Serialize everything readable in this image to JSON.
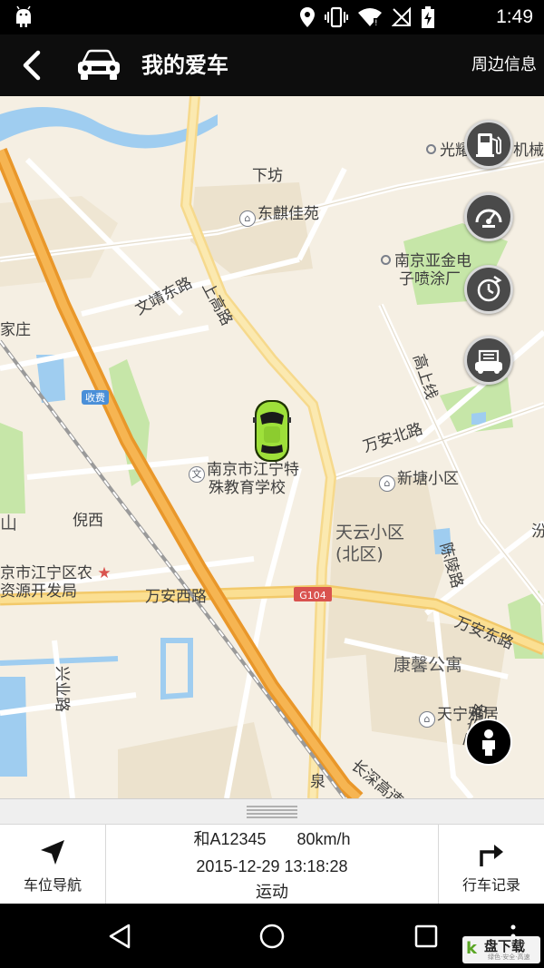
{
  "status_bar": {
    "time": "1:49"
  },
  "header": {
    "title": "我的爱车",
    "nearby_label": "周边信息"
  },
  "map": {
    "labels": {
      "xiafang": "下坊",
      "donglin": "东麒佳苑",
      "guang": "光耀",
      "jixie": "机械厂",
      "yajin1": "南京亚金电",
      "yajin2": "子喷涂厂",
      "wenjing": "文靖东路",
      "shanggao": "上高路",
      "jiazhuang": "家庄",
      "shoufei": "收费",
      "gaoshang": "高上线",
      "wanan_n": "万安北路",
      "school1": "南京市江宁特",
      "school2": "殊教育学校",
      "xintang": "新塘小区",
      "tianyun1": "天云小区",
      "tianyun2": "(北区)",
      "shan": "山",
      "nixi": "倪西",
      "jiangning1": "京市江宁区农",
      "jiangning2": "资源开发局",
      "wanan_w": "万安西路",
      "g104": "G104",
      "chenling": "陈陵路",
      "wanan_e": "万安东路",
      "kangxin": "康馨公寓",
      "tianning": "天宁雅居",
      "xingye": "兴业路",
      "changshen": "长深高速",
      "tianning_rd": "天宁路",
      "quan": "泉",
      "fen": "汾"
    }
  },
  "bottom": {
    "nav_label": "车位导航",
    "record_label": "行车记录",
    "plate": "和A12345",
    "speed": "80km/h",
    "datetime": "2015-12-29 13:18:28",
    "state": "运动"
  },
  "watermark": {
    "brand": "盘下载",
    "sub": "绿色·安全·高速"
  }
}
